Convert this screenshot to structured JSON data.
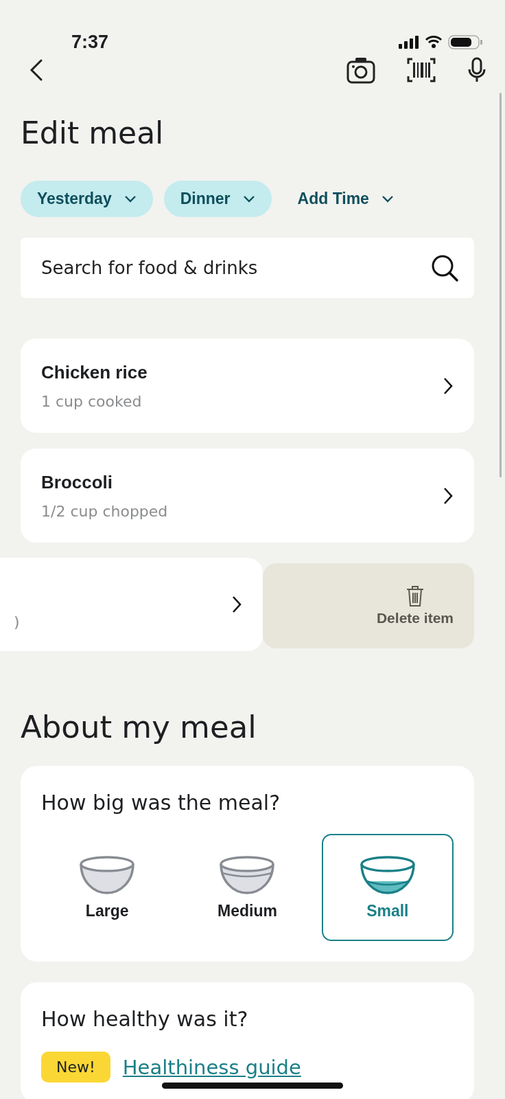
{
  "status_bar": {
    "time": "7:37"
  },
  "title": "Edit meal",
  "chips": [
    {
      "label": "Yesterday",
      "kind": "filled"
    },
    {
      "label": "Dinner",
      "kind": "filled"
    },
    {
      "label": "Add Time",
      "kind": "plain"
    }
  ],
  "search": {
    "placeholder": "Search for food & drinks"
  },
  "food_items": [
    {
      "name": "Chicken rice",
      "portion": "1 cup cooked"
    },
    {
      "name": "Broccoli",
      "portion": "1/2 cup chopped"
    }
  ],
  "swiped_item": {
    "portion": ")",
    "action": "Delete item"
  },
  "section_title": "About my meal",
  "size_card": {
    "question": "How big was the meal?",
    "options": [
      {
        "label": "Large",
        "selected": false,
        "kind": "large"
      },
      {
        "label": "Medium",
        "selected": false,
        "kind": "medium"
      },
      {
        "label": "Small",
        "selected": true,
        "kind": "small"
      }
    ]
  },
  "health_card": {
    "question": "How healthy was it?",
    "badge": "New!",
    "link": "Healthiness guide"
  }
}
